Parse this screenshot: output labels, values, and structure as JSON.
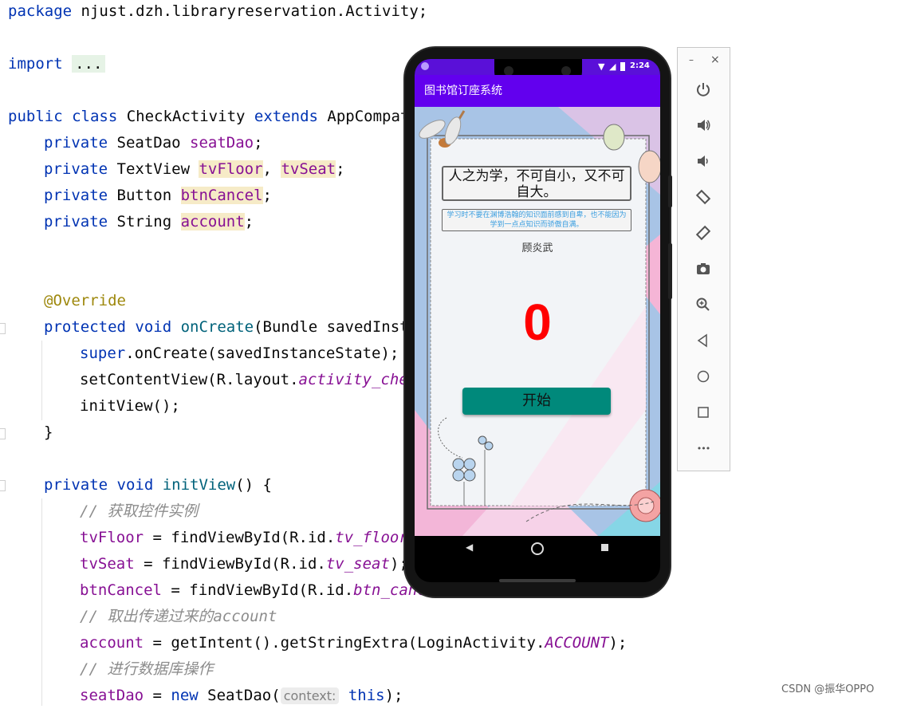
{
  "code": {
    "l1_kw": "package",
    "l1_rest": " njust.dzh.libraryreservation.Activity;",
    "l2_kw": "import",
    "l2_fold": "...",
    "l3_kw1": "public",
    "l3_kw2": "class",
    "l3_name": " CheckActivity ",
    "l3_kw3": "extends",
    "l3_rest": " AppCompatA",
    "l4_kw": "private",
    "l4_type": " SeatDao ",
    "l4_field": "seatDao",
    "l4_end": ";",
    "l5_kw": "private",
    "l5_type": " TextView ",
    "l5_f1": "tvFloor",
    "l5_sep": ", ",
    "l5_f2": "tvSeat",
    "l5_end": ";",
    "l6_kw": "private",
    "l6_type": " Button ",
    "l6_field": "btnCancel",
    "l6_end": ";",
    "l7_kw": "private",
    "l7_type": " String ",
    "l7_field": "account",
    "l7_end": ";",
    "l8_anno": "@Override",
    "l9_kw1": "protected",
    "l9_kw2": " void ",
    "l9_meth": "onCreate",
    "l9_rest": "(Bundle savedInsta",
    "l10_kw": "super",
    "l10_rest": ".onCreate(savedInstanceState);",
    "l11_pre": "setContentView(R.layout.",
    "l11_ital": "activity_chec",
    "l12_text": "initView();",
    "l13_text": "}",
    "l14_kw1": "private",
    "l14_kw2": " void ",
    "l14_meth": "initView",
    "l14_rest": "() {",
    "l15_cmt": "// 获取控件实例",
    "l16_field": "tvFloor",
    "l16_pre": " = findViewById(R.id.",
    "l16_ital": "tv_floor",
    "l17_field": "tvSeat",
    "l17_pre": " = findViewById(R.id.",
    "l17_ital": "tv_seat",
    "l17_end": ");",
    "l18_field": "btnCancel",
    "l18_pre": " = findViewById(R.id.",
    "l18_ital": "btn_canc",
    "l19_cmt": "// 取出传递过来的account",
    "l20_field": "account",
    "l20_pre": " = getIntent().getStringExtra(LoginActivity.",
    "l20_ital": "ACCOUNT",
    "l20_end": ");",
    "l21_cmt": "// 进行数据库操作",
    "l22_field": "seatDao",
    "l22_eq": " = ",
    "l22_kw": "new",
    "l22_pre": " SeatDao(",
    "l22_hint": "context:",
    "l22_kw2": " this",
    "l22_end": ");"
  },
  "phone": {
    "status_time": "2:24",
    "app_title": "图书馆订座系统",
    "quote_main": "人之为学，不可自小，又不可自大。",
    "quote_sub": "学习时不要在渊博浩翰的知识面前感到自卑，也不能因为学到一点点知识而骄傲自满。",
    "author": "顾炎武",
    "counter": "0",
    "start_button": "开始"
  },
  "emulator_toolbar": {
    "minimize": "–",
    "close": "×",
    "more": "•••"
  },
  "watermark": "CSDN @振华OPPO",
  "colors": {
    "accent": "#6200ee",
    "counter": "#ff0000",
    "button": "#00897b"
  }
}
